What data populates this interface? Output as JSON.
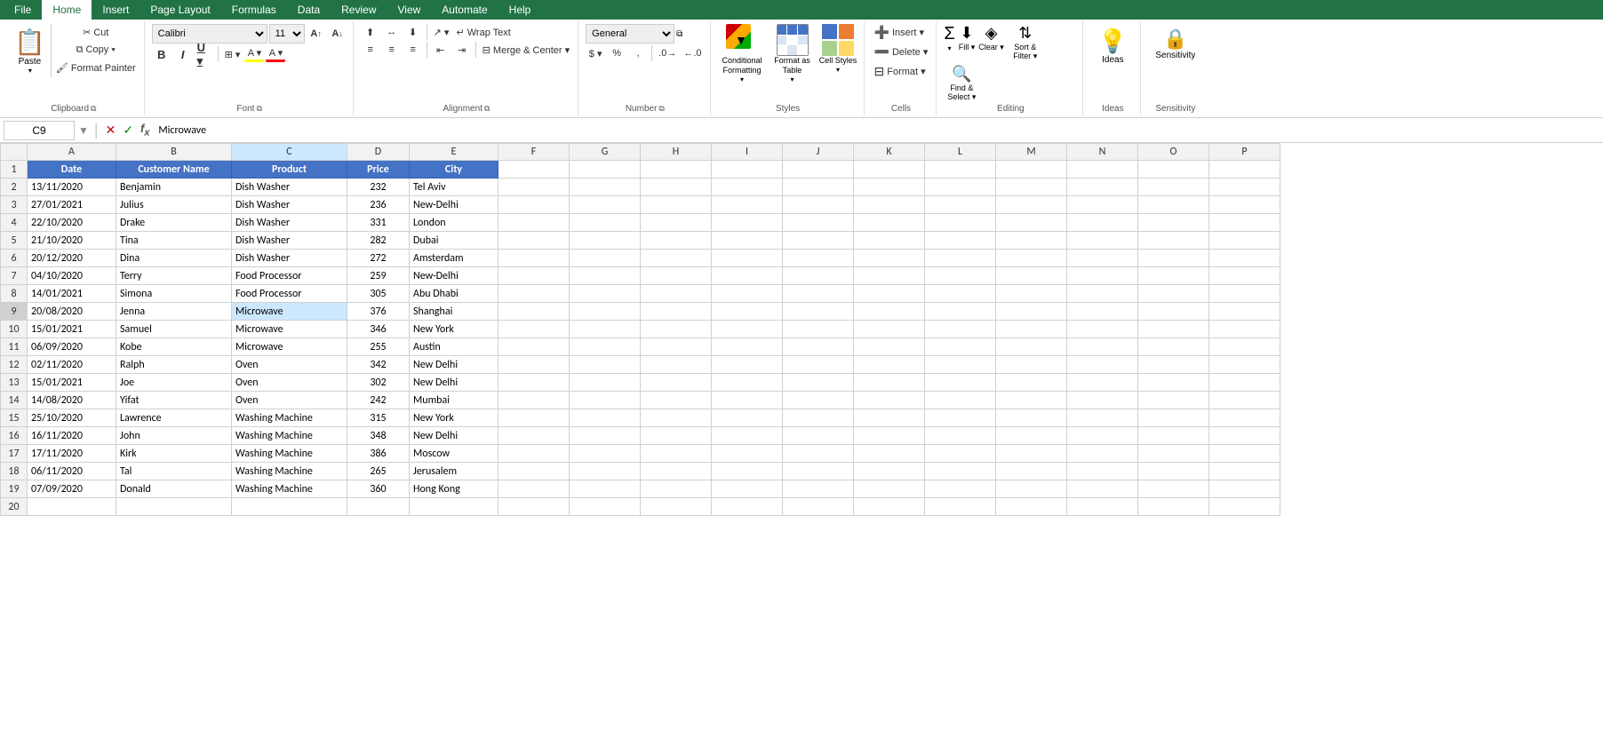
{
  "ribbon": {
    "tabs": [
      "File",
      "Home",
      "Insert",
      "Page Layout",
      "Formulas",
      "Data",
      "Review",
      "View",
      "Automate",
      "Help"
    ],
    "active_tab": "Home"
  },
  "groups": {
    "clipboard": {
      "label": "Clipboard",
      "paste": "Paste",
      "cut": "✂",
      "copy": "⧉",
      "format_painter": "🖌"
    },
    "font": {
      "label": "Font",
      "font_name": "Calibri",
      "font_size": "11",
      "bold": "B",
      "italic": "I",
      "underline": "U",
      "border": "⊞",
      "fill": "A",
      "color": "A",
      "increase": "A↑",
      "decrease": "A↓"
    },
    "alignment": {
      "label": "Alignment",
      "top": "⬆",
      "middle": "↔",
      "bottom": "⬇",
      "left": "≡",
      "center": "≡",
      "right": "≡",
      "wrap": "↵",
      "merge": "⊡",
      "indent_dec": "⇤",
      "indent_inc": "⇥",
      "orientation": "↗"
    },
    "number": {
      "label": "Number",
      "format": "General",
      "percent": "%",
      "comma": ",",
      "currency": "$",
      "inc_decimal": ".0",
      "dec_decimal": ".00"
    },
    "styles": {
      "label": "Styles",
      "conditional": "Conditional\nFormatting",
      "format_table": "Format as\nTable",
      "cell_styles": "Cell Styles"
    },
    "cells": {
      "label": "Cells",
      "insert": "Insert",
      "delete": "Delete",
      "format": "Format"
    },
    "editing": {
      "label": "Editing",
      "autosum": "Σ",
      "fill": "⬇",
      "clear": "◈",
      "sort_filter": "Sort &\nFilter",
      "find_select": "Find &\nSelect"
    },
    "ideas": {
      "label": "Ideas",
      "btn": "Ideas"
    },
    "sensitivity": {
      "label": "Sensitivity",
      "btn": "Sensitivity"
    }
  },
  "formula_bar": {
    "name_box": "C9",
    "formula": "Microwave"
  },
  "spreadsheet": {
    "columns": [
      "A",
      "B",
      "C",
      "D",
      "E",
      "F",
      "G",
      "H",
      "I",
      "J",
      "K",
      "L",
      "M",
      "N",
      "O",
      "P"
    ],
    "headers": [
      "Date",
      "Customer Name",
      "Product",
      "Price",
      "City"
    ],
    "rows": [
      [
        "13/11/2020",
        "Benjamin",
        "Dish Washer",
        "232",
        "Tel Aviv"
      ],
      [
        "27/01/2021",
        "Julius",
        "Dish Washer",
        "236",
        "New-Delhi"
      ],
      [
        "22/10/2020",
        "Drake",
        "Dish Washer",
        "331",
        "London"
      ],
      [
        "21/10/2020",
        "Tina",
        "Dish Washer",
        "282",
        "Dubai"
      ],
      [
        "20/12/2020",
        "Dina",
        "Dish Washer",
        "272",
        "Amsterdam"
      ],
      [
        "04/10/2020",
        "Terry",
        "Food Processor",
        "259",
        "New-Delhi"
      ],
      [
        "14/01/2021",
        "Simona",
        "Food Processor",
        "305",
        "Abu Dhabi"
      ],
      [
        "20/08/2020",
        "Jenna",
        "Microwave",
        "376",
        "Shanghai"
      ],
      [
        "15/01/2021",
        "Samuel",
        "Microwave",
        "346",
        "New York"
      ],
      [
        "06/09/2020",
        "Kobe",
        "Microwave",
        "255",
        "Austin"
      ],
      [
        "02/11/2020",
        "Ralph",
        "Oven",
        "342",
        "New Delhi"
      ],
      [
        "15/01/2021",
        "Joe",
        "Oven",
        "302",
        "New Delhi"
      ],
      [
        "14/08/2020",
        "Yifat",
        "Oven",
        "242",
        "Mumbai"
      ],
      [
        "25/10/2020",
        "Lawrence",
        "Washing Machine",
        "315",
        "New York"
      ],
      [
        "16/11/2020",
        "John",
        "Washing Machine",
        "348",
        "New Delhi"
      ],
      [
        "17/11/2020",
        "Kirk",
        "Washing Machine",
        "386",
        "Moscow"
      ],
      [
        "06/11/2020",
        "Tal",
        "Washing Machine",
        "265",
        "Jerusalem"
      ],
      [
        "07/09/2020",
        "Donald",
        "Washing Machine",
        "360",
        "Hong Kong"
      ]
    ],
    "selected_cell": "C9",
    "selected_row": 9,
    "selected_col": "C"
  }
}
